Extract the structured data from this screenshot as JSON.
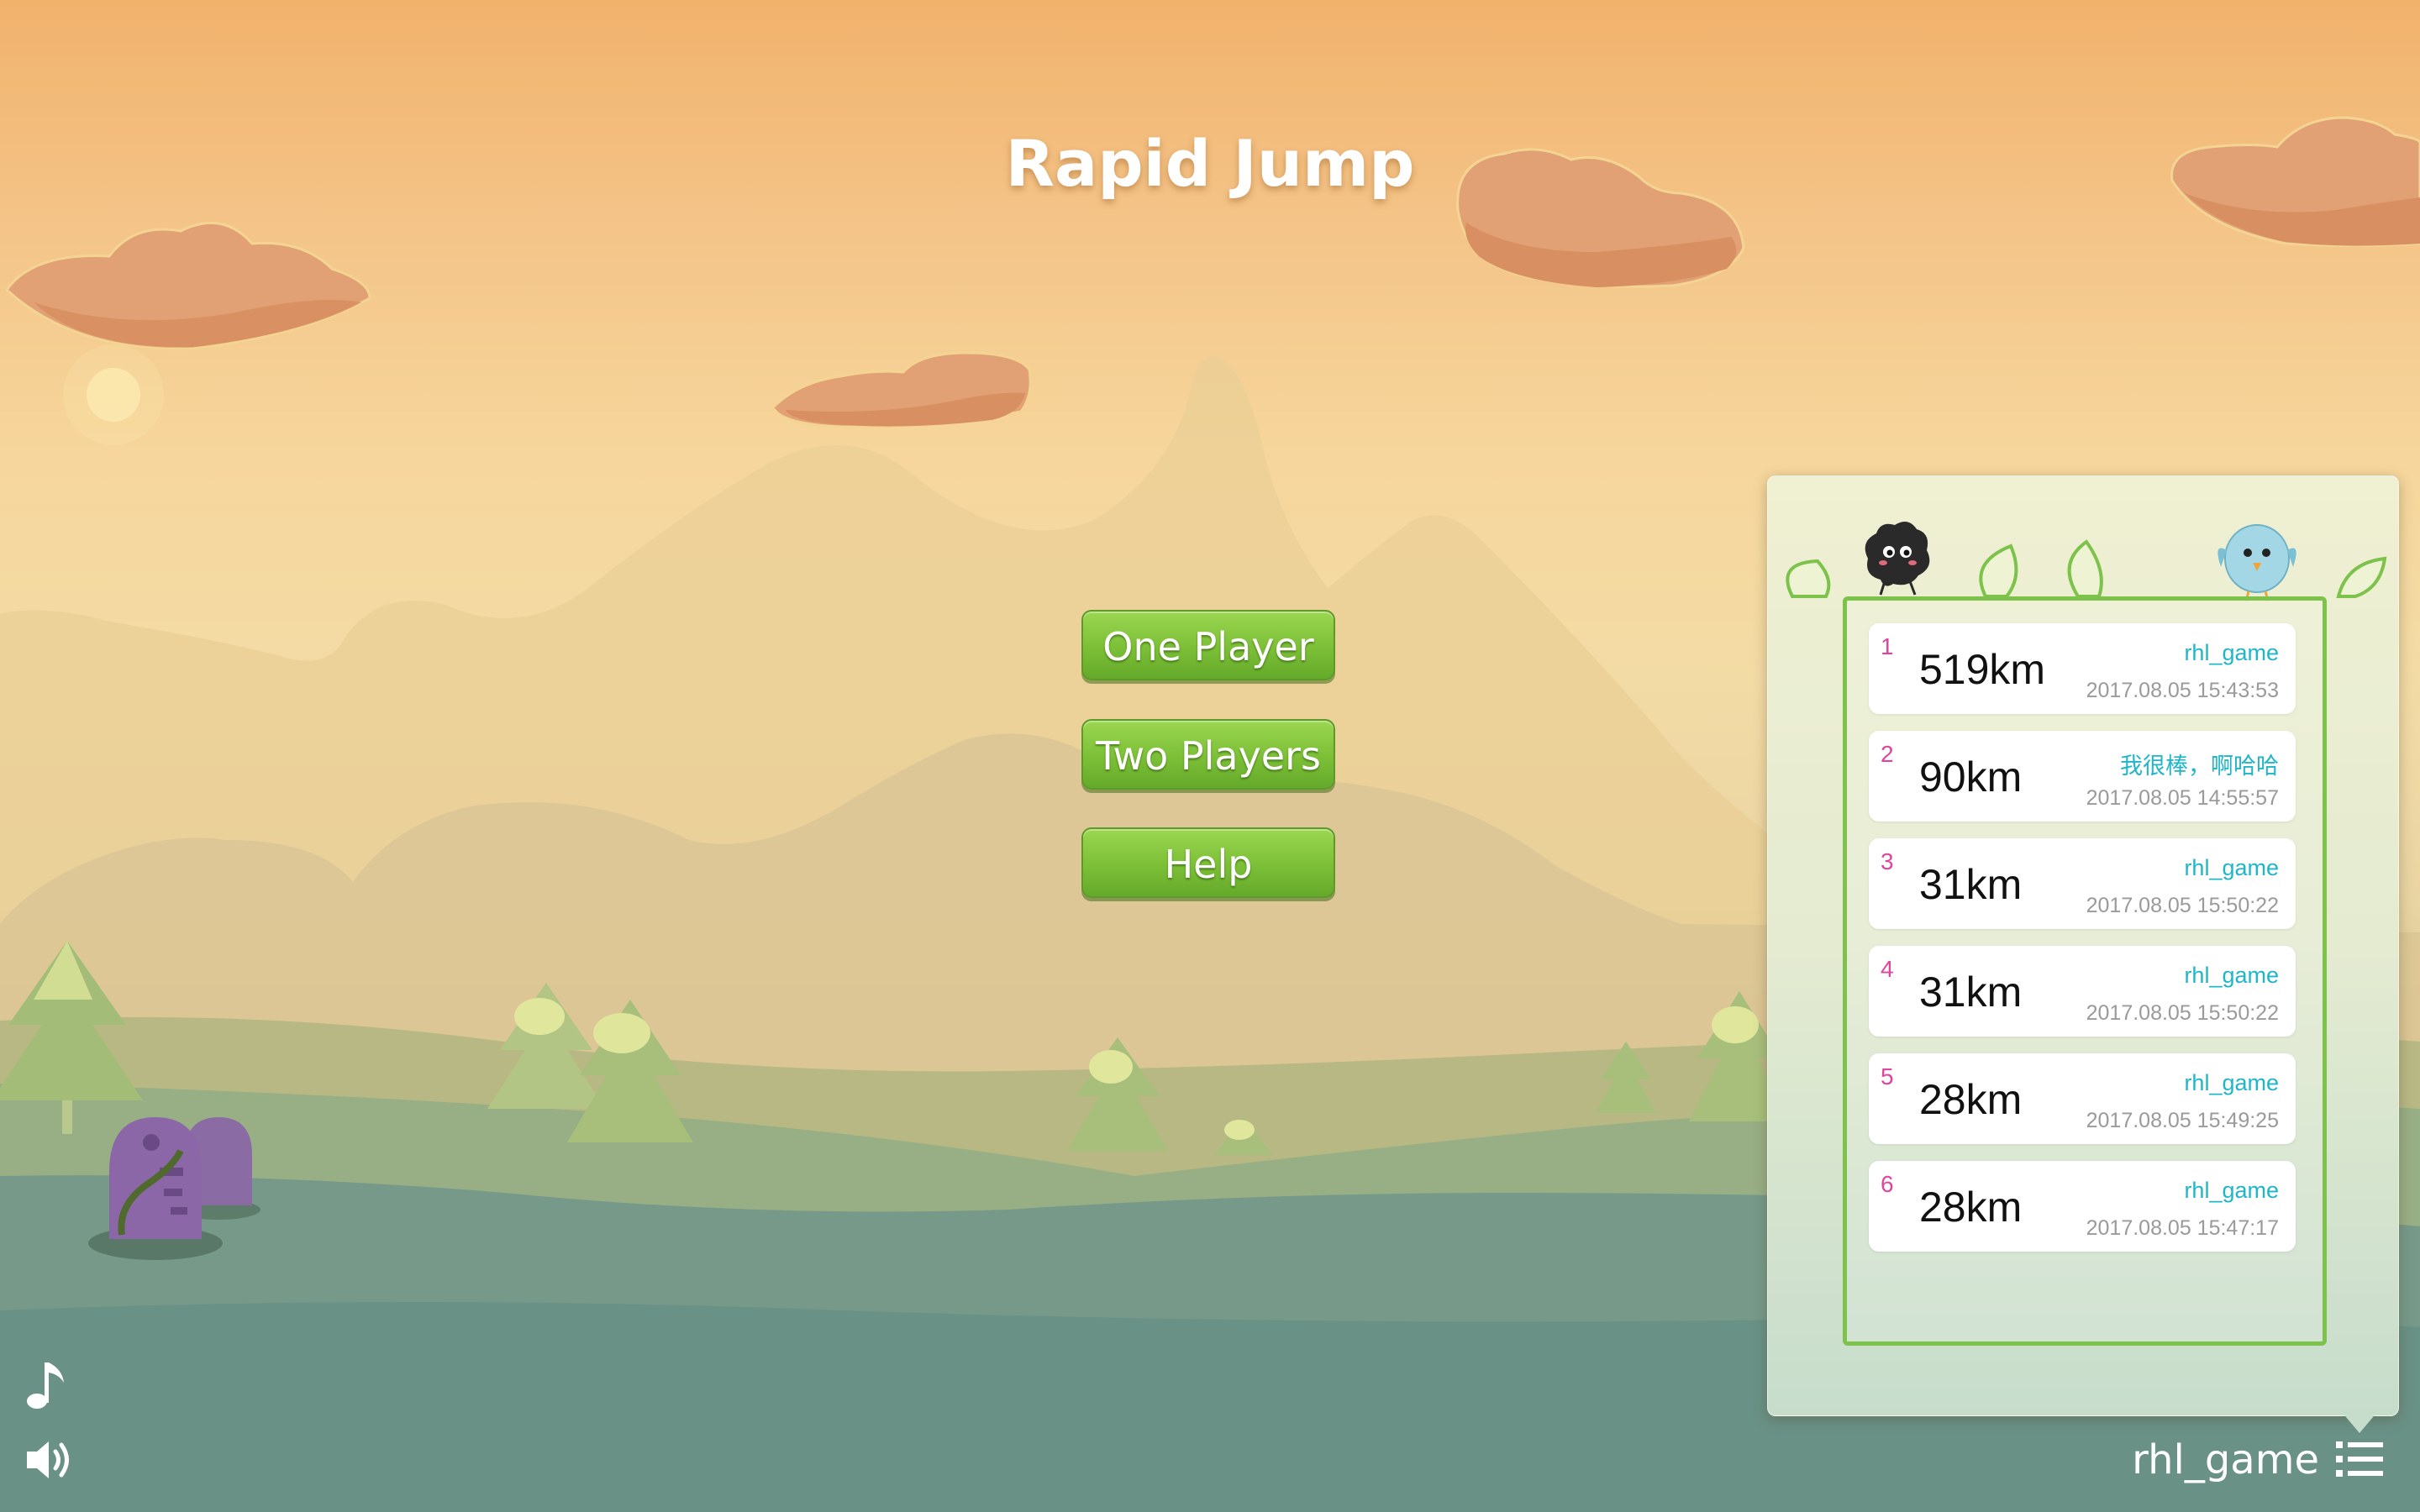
{
  "game": {
    "title": "Rapid Jump",
    "buttons": {
      "one_player": "One Player",
      "two_players": "Two Players",
      "help": "Help"
    }
  },
  "leaderboard": {
    "entries": [
      {
        "rank": "1",
        "distance": "519km",
        "name": "rhl_game",
        "time": "2017.08.05 15:43:53"
      },
      {
        "rank": "2",
        "distance": "90km",
        "name": "我很棒，啊哈哈",
        "time": "2017.08.05 14:55:57"
      },
      {
        "rank": "3",
        "distance": "31km",
        "name": "rhl_game",
        "time": "2017.08.05 15:50:22"
      },
      {
        "rank": "4",
        "distance": "31km",
        "name": "rhl_game",
        "time": "2017.08.05 15:50:22"
      },
      {
        "rank": "5",
        "distance": "28km",
        "name": "rhl_game",
        "time": "2017.08.05 15:49:25"
      },
      {
        "rank": "6",
        "distance": "28km",
        "name": "rhl_game",
        "time": "2017.08.05 15:47:17"
      }
    ]
  },
  "footer": {
    "username": "rhl_game",
    "icons": {
      "music": "music-note-icon",
      "sound": "speaker-icon",
      "list": "list-icon"
    }
  },
  "colors": {
    "button_green": "#7cbf37",
    "frame_green": "#7cc24b",
    "rank_pink": "#e0449c",
    "name_cyan": "#1fb6c9",
    "time_gray": "#9a9a9a"
  }
}
